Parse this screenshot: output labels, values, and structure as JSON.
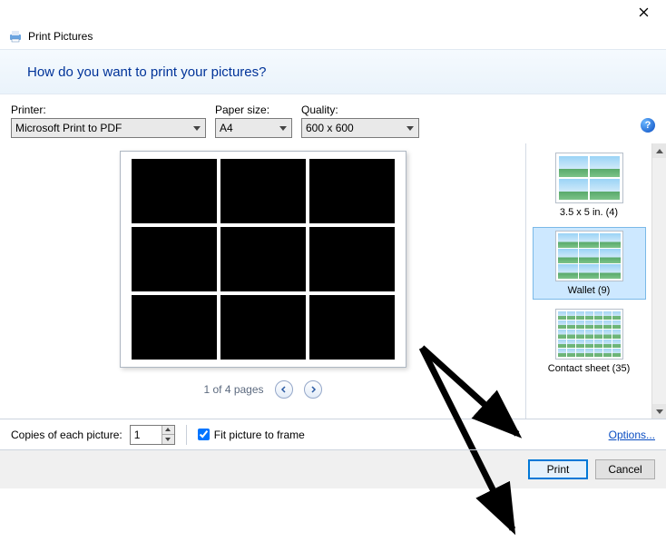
{
  "window": {
    "title": "Print Pictures"
  },
  "question": "How do you want to print your pictures?",
  "labels": {
    "printer": "Printer:",
    "paper": "Paper size:",
    "quality": "Quality:",
    "copies": "Copies of each picture:",
    "fit": "Fit picture to frame",
    "options": "Options...",
    "help": "?"
  },
  "selects": {
    "printer": "Microsoft Print to PDF",
    "paper": "A4",
    "quality": "600 x 600"
  },
  "pager": {
    "label": "1 of 4 pages"
  },
  "copies_value": "1",
  "fit_checked": true,
  "layouts": [
    {
      "label": "3.5 x 5 in. (4)",
      "selected": false
    },
    {
      "label": "Wallet (9)",
      "selected": true
    },
    {
      "label": "Contact sheet (35)",
      "selected": false
    }
  ],
  "buttons": {
    "print": "Print",
    "cancel": "Cancel"
  }
}
